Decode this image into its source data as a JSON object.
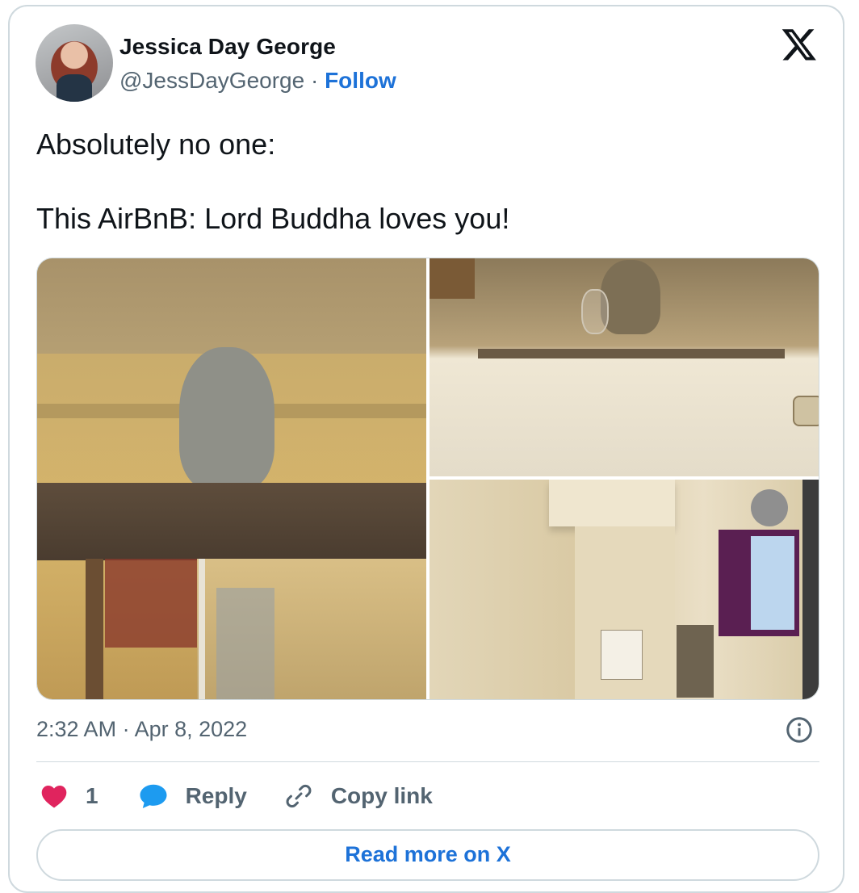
{
  "author": {
    "name": "Jessica Day George",
    "handle": "@JessDayGeorge",
    "separator": "·",
    "follow_label": "Follow"
  },
  "tweet": {
    "text": "Absolutely no one:\n\nThis AirBnB: Lord Buddha loves you!",
    "timestamp": "2:32 AM · Apr 8, 2022"
  },
  "media": [
    {
      "label": "photo-buddha-statue-on-shelf"
    },
    {
      "label": "photo-buddha-on-refrigerator"
    },
    {
      "label": "photo-bathroom-wall"
    }
  ],
  "actions": {
    "like_count": "1",
    "reply_label": "Reply",
    "copy_link_label": "Copy link"
  },
  "read_more_label": "Read more on X",
  "colors": {
    "accent": "#1d72d8",
    "heart": "#e0245e",
    "reply_bubble": "#1d9bf0",
    "secondary_text": "#536471",
    "border": "#cfd9de"
  },
  "icons": {
    "logo": "x-logo-icon",
    "info": "info-icon",
    "like": "heart-icon",
    "reply": "reply-bubble-icon",
    "copy": "link-icon"
  }
}
